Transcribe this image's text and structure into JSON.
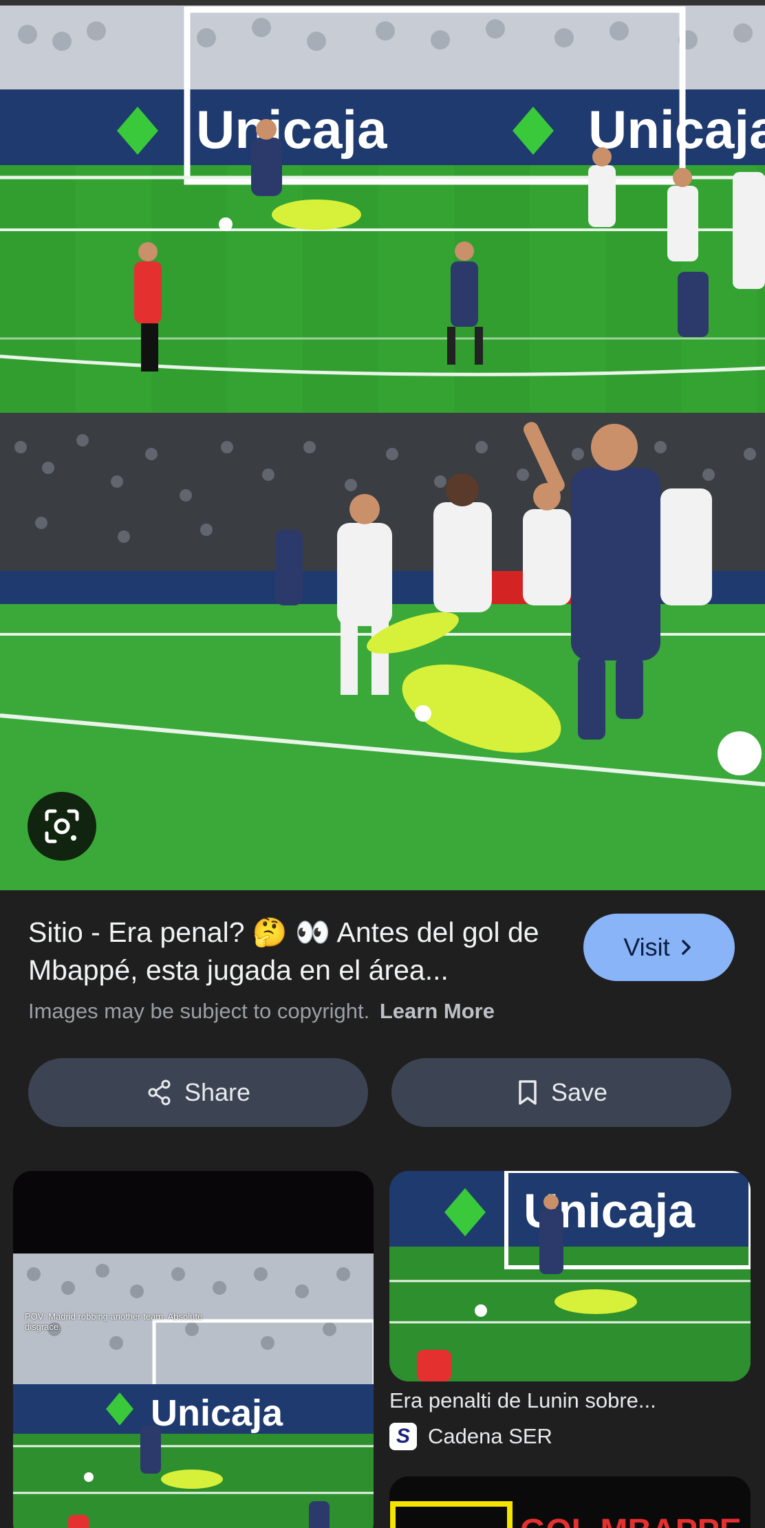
{
  "hero": {
    "banner_text_top": "Unicaja",
    "banner_text_bottom": "Unicaja",
    "lens_icon": "lens-icon"
  },
  "result": {
    "title": "Sitio - Era penal? 🤔 👀 Antes del gol de Mbappé, esta jugada en el área...",
    "visit_label": "Visit",
    "copyright_text": "Images may be subject to copyright.",
    "learn_more_label": "Learn More"
  },
  "actions": {
    "share_label": "Share",
    "save_label": "Save"
  },
  "related": {
    "left_card": {
      "caption": "POV: Madrid robbing another team. Absolute disgrace.",
      "banner_text": "Unicaja"
    },
    "right_card": {
      "banner_text": "Unicaja",
      "title": "Era penalti de Lunin sobre...",
      "source_initial": "S",
      "source": "Cadena SER"
    },
    "right_card2": {
      "banner_text": "GOL MBAPPE"
    }
  },
  "colors": {
    "background": "#1f1f1f",
    "visit_button": "#8ab4f8",
    "action_button": "#3c4454",
    "pitch": "#2e8b2e"
  }
}
